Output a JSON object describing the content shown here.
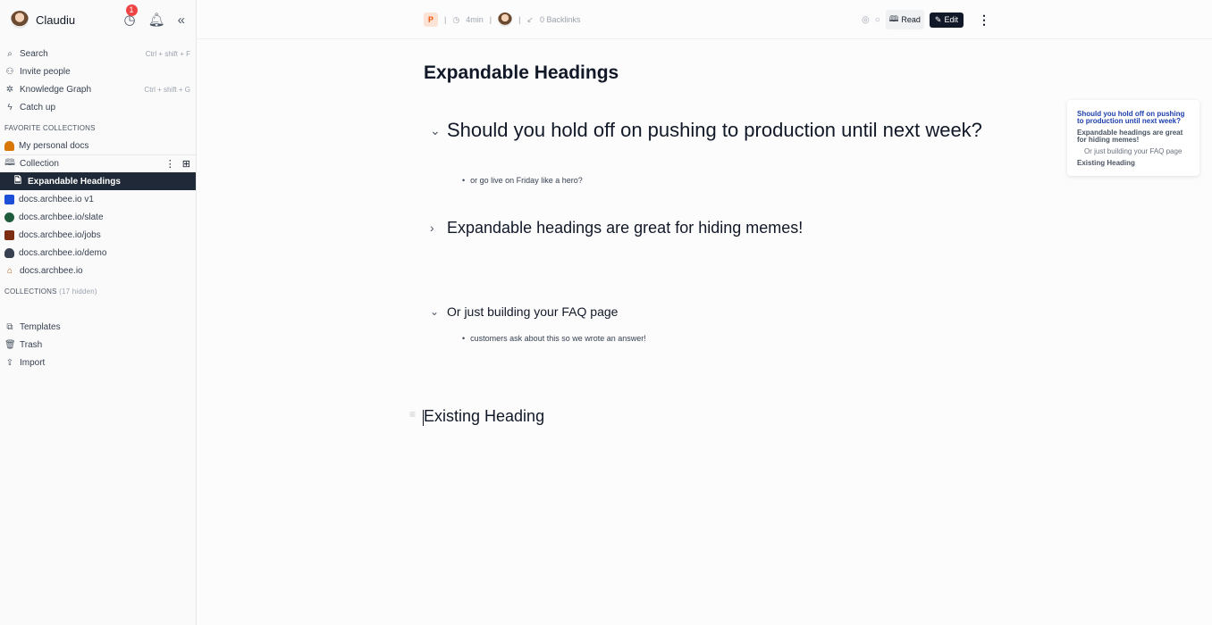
{
  "sidebar": {
    "user_name": "Claudiu",
    "notification_count": "1",
    "top_items": [
      {
        "label": "Search",
        "shortcut": "Ctrl + shift + F"
      },
      {
        "label": "Invite people",
        "shortcut": ""
      },
      {
        "label": "Knowledge Graph",
        "shortcut": "Ctrl + shift + G"
      },
      {
        "label": "Catch up",
        "shortcut": ""
      }
    ],
    "favorites_heading": "FAVORITE COLLECTIONS",
    "favorites": [
      {
        "label": "My personal docs"
      },
      {
        "label": "Collection"
      },
      {
        "label": "Expandable Headings"
      },
      {
        "label": "docs.archbee.io v1"
      },
      {
        "label": "docs.archbee.io/slate"
      },
      {
        "label": "docs.archbee.io/jobs"
      },
      {
        "label": "docs.archbee.io/demo"
      },
      {
        "label": "docs.archbee.io"
      }
    ],
    "collections_heading": "COLLECTIONS",
    "collections_hidden": "(17 hidden)",
    "bottom_items": [
      {
        "label": "Templates"
      },
      {
        "label": "Trash"
      },
      {
        "label": "Import"
      }
    ]
  },
  "topbar": {
    "doc_badge": "P",
    "read_time": "4min",
    "backlinks": "0 Backlinks",
    "read_label": "Read",
    "edit_label": "Edit"
  },
  "doc": {
    "title": "Expandable Headings",
    "heading1": "Should you hold off on pushing to production until next week?",
    "bullet1": "or go live on Friday like a hero?",
    "heading2": "Expandable headings are great for hiding memes!",
    "heading3": "Or just building your FAQ page",
    "bullet2": "customers ask about this so we wrote an answer!",
    "heading4": "Existing Heading"
  },
  "toc": {
    "items": [
      {
        "label": "Should you hold off on pushing to production until next week?"
      },
      {
        "label": "Expandable headings are great for hiding memes!"
      },
      {
        "label": "Or just building your FAQ page"
      },
      {
        "label": "Existing Heading"
      }
    ]
  },
  "colors": {
    "active_item_bg": "#1f2937",
    "badge_red": "#ef4444",
    "toc_active": "#1e40af"
  }
}
